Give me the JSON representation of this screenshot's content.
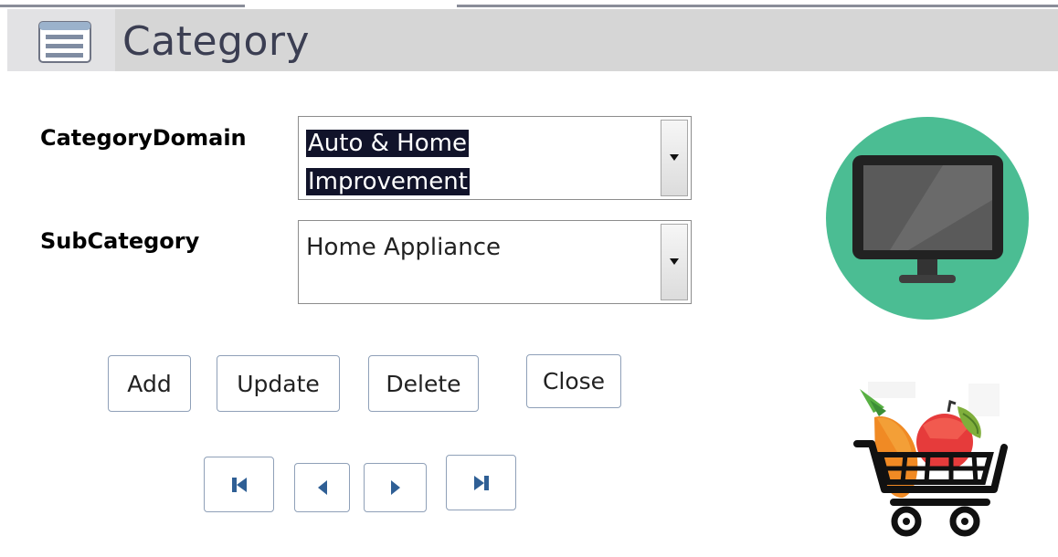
{
  "header": {
    "title": "Category",
    "icon": "form-icon"
  },
  "form": {
    "category_domain": {
      "label": "CategoryDomain",
      "value_line1": "Auto & Home",
      "value_line2": "Improvement"
    },
    "sub_category": {
      "label": "SubCategory",
      "value": "Home Appliance"
    }
  },
  "buttons": {
    "add": "Add",
    "update": "Update",
    "delete": "Delete",
    "close": "Close"
  },
  "navigation": {
    "first": "first-record-icon",
    "previous": "previous-record-icon",
    "next": "next-record-icon",
    "last": "last-record-icon"
  },
  "images": {
    "monitor": "monitor-icon",
    "cart": "shopping-cart-icon"
  },
  "colors": {
    "header_background": "#d6d6d6",
    "title_text": "#3b3e52",
    "selection_background": "#11132a",
    "nav_icon": "#2f5f95",
    "monitor_circle": "#4bbd93"
  }
}
